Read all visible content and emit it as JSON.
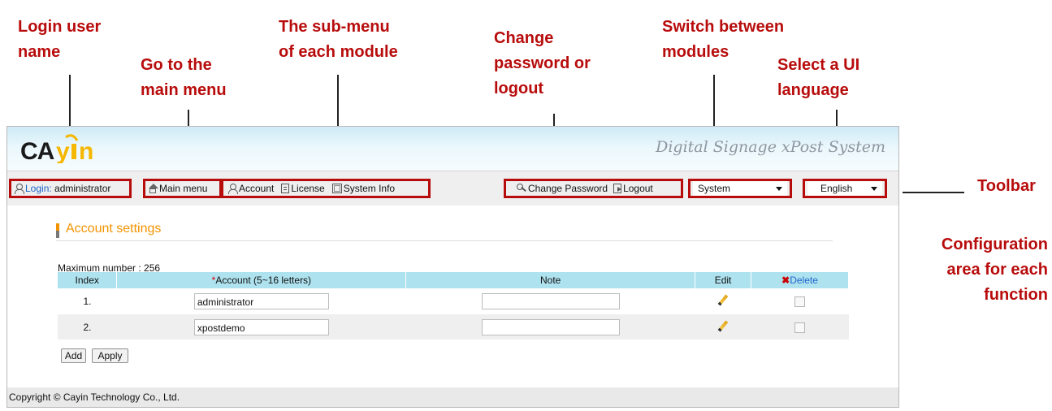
{
  "annotations": {
    "login_user": [
      "Login user",
      "name"
    ],
    "main_menu": [
      "Go to the",
      "main menu"
    ],
    "submenu": [
      "The sub-menu",
      "of each module"
    ],
    "change_pw": [
      "Change",
      "password or",
      "logout"
    ],
    "switch_modules": [
      "Switch between",
      "modules"
    ],
    "ui_language": [
      "Select a UI",
      "language"
    ],
    "toolbar": "Toolbar",
    "config_area": [
      "Configuration",
      "area for each",
      "function"
    ]
  },
  "app": {
    "logo_text": "CAYIN",
    "tagline": "Digital Signage xPost System"
  },
  "toolbar": {
    "login_label": "Login:",
    "login_user": "administrator",
    "main_menu": "Main menu",
    "account": "Account",
    "license": "License",
    "system_info": "System Info",
    "change_password": "Change Password",
    "logout": "Logout",
    "module_selected": "System",
    "language_selected": "English"
  },
  "content": {
    "section_title": "Account settings",
    "max_number": "Maximum number : 256",
    "columns": {
      "index": "Index",
      "account_req": "*",
      "account": "Account (5~16 letters)",
      "note": "Note",
      "edit": "Edit",
      "delete_mark": "✖",
      "delete": "Delete"
    },
    "rows": [
      {
        "index": "1.",
        "account": "administrator",
        "note": ""
      },
      {
        "index": "2.",
        "account": "xpostdemo",
        "note": ""
      }
    ],
    "add_button": "Add",
    "apply_button": "Apply"
  },
  "footer": {
    "copyright": "Copyright © Cayin Technology Co., Ltd."
  },
  "colors": {
    "annotation": "#b80c0c",
    "highlight_border": "#b70c0c",
    "section_title": "#f39300",
    "table_header": "#aee2ef"
  }
}
